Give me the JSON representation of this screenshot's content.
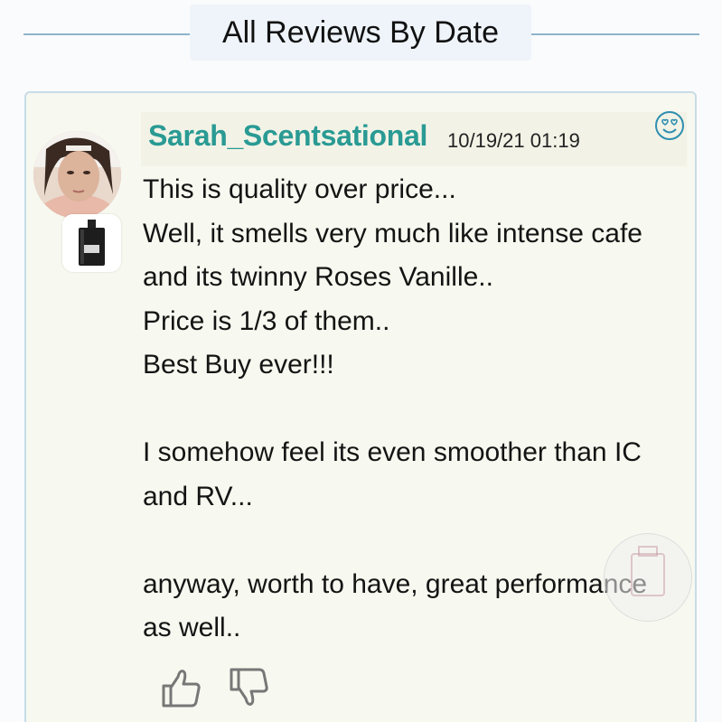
{
  "header": {
    "title": "All Reviews By Date"
  },
  "review": {
    "author": "Sarah_Scentsational",
    "timestamp": "10/19/21 01:19",
    "reaction_icon": "heart-eyes-emoji-icon",
    "lines": [
      "This is quality over price...",
      "Well, it smells very much like intense cafe",
      "and its twinny Roses Vanille..",
      "Price is 1/3 of them..",
      "Best Buy ever!!!",
      "",
      "I somehow feel its even smoother than IC",
      "and RV...",
      "",
      "anyway, worth to have, great performance",
      "as well.."
    ],
    "actions": {
      "upvote_icon": "thumbs-up-icon",
      "downvote_icon": "thumbs-down-icon"
    }
  },
  "colors": {
    "author": "#2a9a94",
    "card_background": "#f7f8ef",
    "card_border": "#c7dce8",
    "header_line": "#8fb4cc",
    "header_background": "#eef4fa"
  }
}
